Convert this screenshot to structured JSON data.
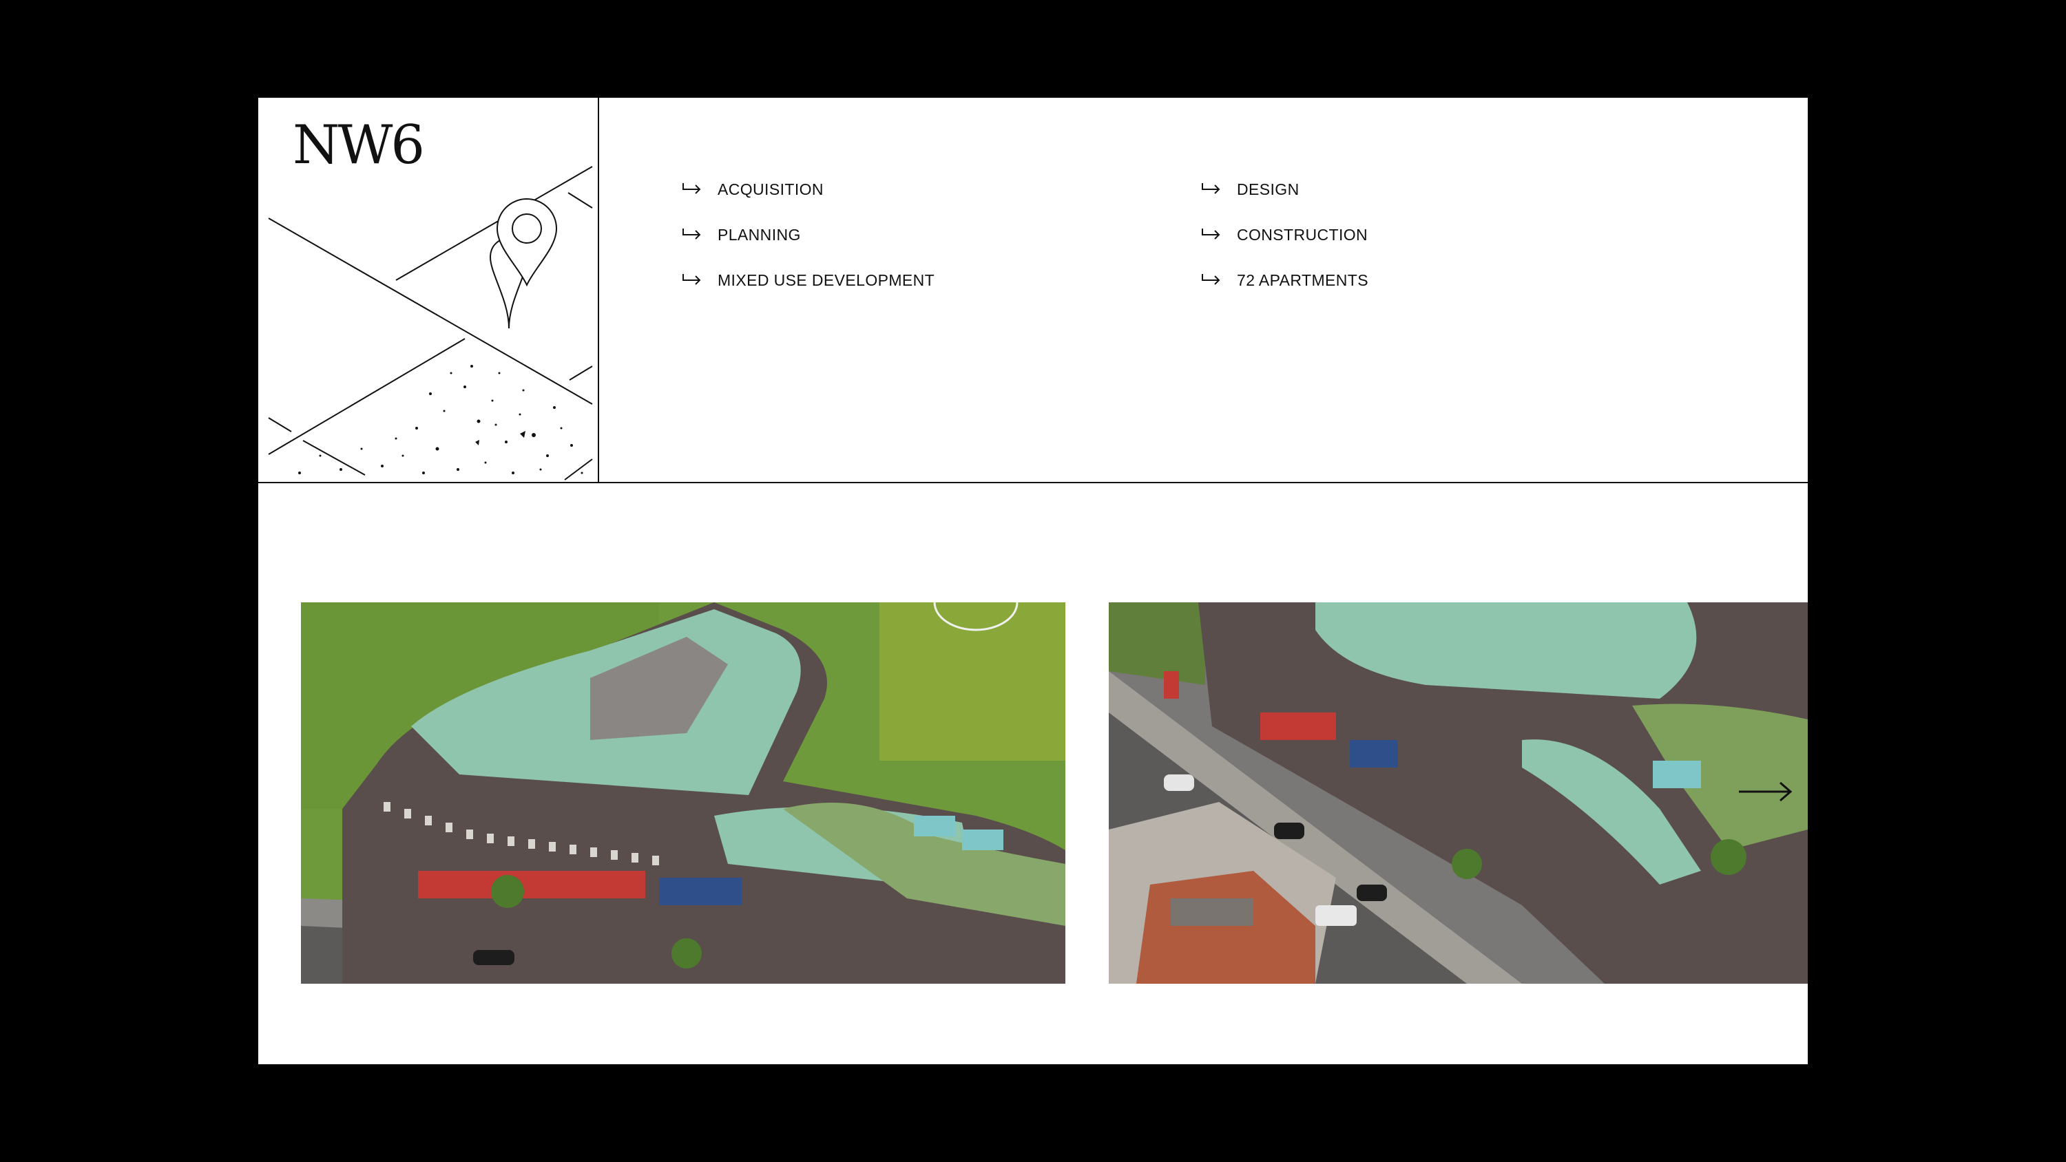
{
  "project": {
    "title": "NW6"
  },
  "services": {
    "left": [
      {
        "label": "ACQUISITION"
      },
      {
        "label": "PLANNING"
      },
      {
        "label": "MIXED USE DEVELOPMENT"
      }
    ],
    "right": [
      {
        "label": "DESIGN"
      },
      {
        "label": "CONSTRUCTION"
      },
      {
        "label": "72 APARTMENTS"
      }
    ]
  },
  "icons": {
    "service_arrow": "return-arrow-icon",
    "map_pin": "location-pin-icon",
    "gallery_next": "arrow-right-icon"
  },
  "colors": {
    "background": "#000000",
    "card": "#ffffff",
    "ink": "#111111",
    "roof": "#8fc4ad",
    "brick": "#5a4e4c",
    "grass": "#6f9a3c"
  }
}
